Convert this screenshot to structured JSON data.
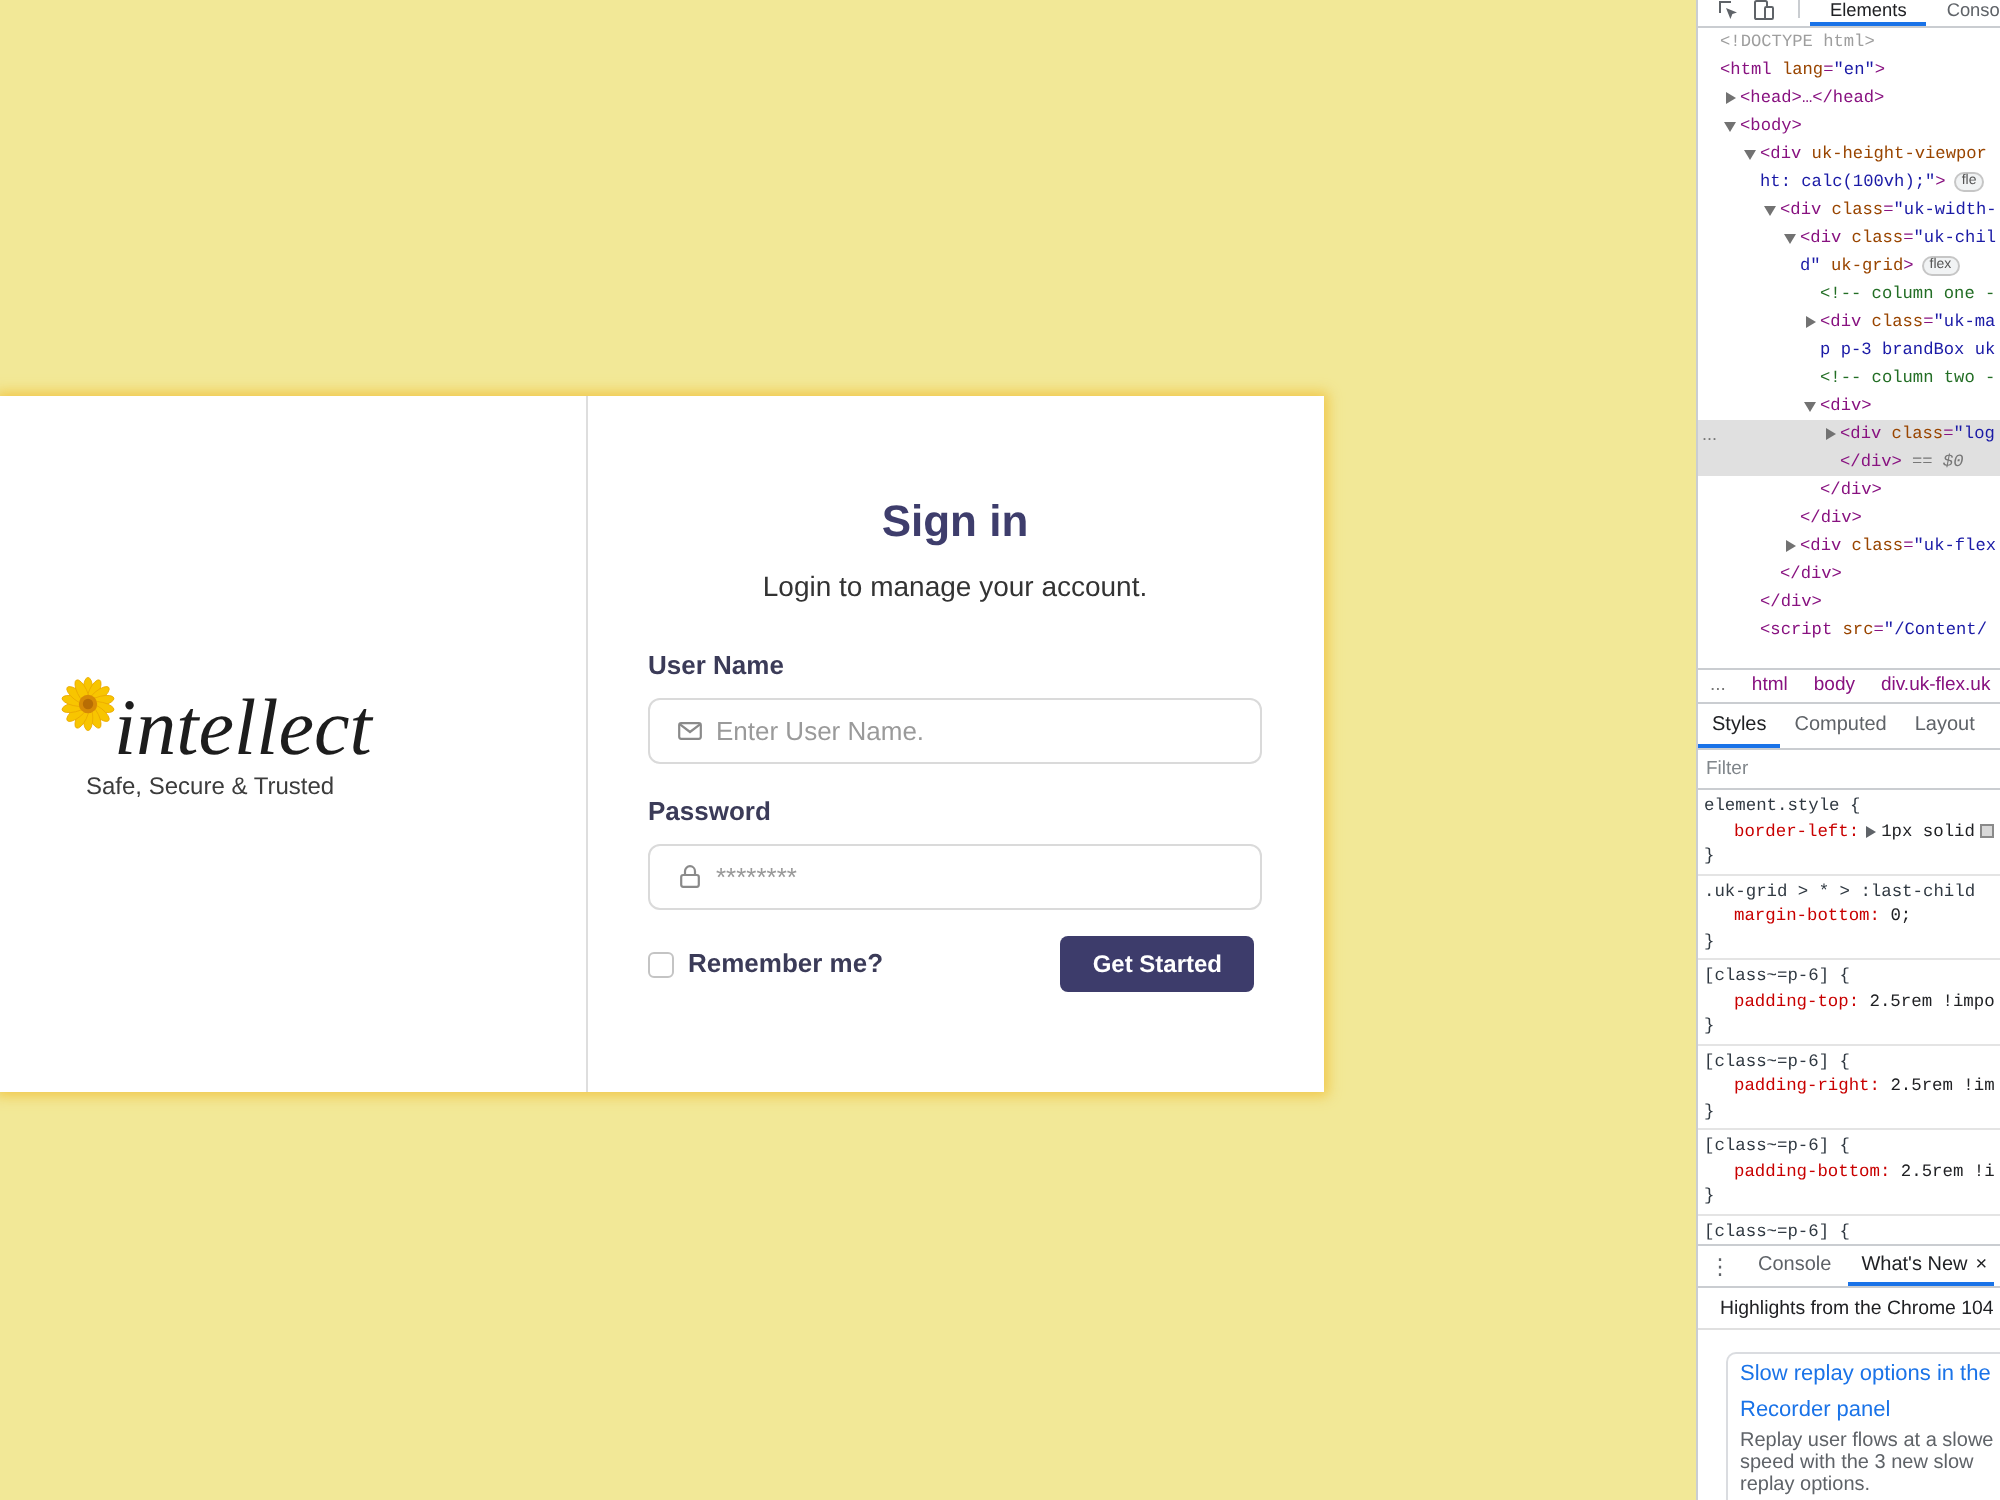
{
  "main": {
    "logo": {
      "wordmark": "intellect",
      "tagline": "Safe, Secure & Trusted"
    },
    "sign_in": {
      "title": "Sign in",
      "subtitle": "Login to manage your account.",
      "fields": [
        {
          "kind": "username",
          "label": "User Name",
          "placeholder": "Enter User Name."
        },
        {
          "kind": "password",
          "label": "Password",
          "placeholder": "********"
        }
      ],
      "remember": {
        "label": "Remember me?",
        "checked": false
      },
      "submit": "Get Started"
    }
  },
  "devtools": {
    "tabs": [
      {
        "label": "Elements",
        "selected": true
      },
      {
        "label": "Conso",
        "selected": false
      }
    ],
    "dom_tree": {
      "row_menu": "...",
      "nodes": [
        {
          "kind": "doctype",
          "lines": [
            "<!DOCTYPE html>"
          ],
          "selected": false
        },
        {
          "kind": "element",
          "lines": [
            "<html lang=\"en\">"
          ],
          "selected": false,
          "children": [
            {
              "kind": "element",
              "lines": [
                "<head>…</head>"
              ],
              "expanded": false,
              "selected": false
            },
            {
              "kind": "element",
              "lines": [
                "<body>"
              ],
              "expanded": true,
              "selected": false,
              "children": [
                {
                  "kind": "element",
                  "lines": [
                    "<div uk-height-viewpor",
                    "ht: calc(100vh);\">"
                  ],
                  "badge": "fle",
                  "expanded": true,
                  "selected": false,
                  "children": [
                    {
                      "kind": "element",
                      "lines": [
                        "<div class=\"uk-width-"
                      ],
                      "expanded": true,
                      "selected": false,
                      "children": [
                        {
                          "kind": "element",
                          "lines": [
                            "<div class=\"uk-chil",
                            "d\" uk-grid>"
                          ],
                          "badge": "flex",
                          "expanded": true,
                          "selected": false,
                          "children": [
                            {
                              "kind": "comment",
                              "lines": [
                                "<!-- column one -"
                              ],
                              "selected": false
                            },
                            {
                              "kind": "element",
                              "lines": [
                                "<div class=\"uk-ma",
                                "p p-3 brandBox uk"
                              ],
                              "expanded": false,
                              "selected": false
                            },
                            {
                              "kind": "comment",
                              "lines": [
                                "<!-- column two -"
                              ],
                              "selected": false
                            },
                            {
                              "kind": "element",
                              "lines": [
                                "<div>"
                              ],
                              "expanded": true,
                              "selected": false,
                              "children": [
                                {
                                  "kind": "element",
                                  "lines": [
                                    "<div class=\"log",
                                    "</div>"
                                  ],
                                  "console_ref": "== $0",
                                  "expanded": false,
                                  "selected": true
                                }
                              ],
                              "closing": "</div>"
                            }
                          ],
                          "closing": "</div>"
                        },
                        {
                          "kind": "element",
                          "lines": [
                            "<div class=\"uk-flex"
                          ],
                          "expanded": false,
                          "selected": false
                        }
                      ],
                      "closing": "</div>"
                    }
                  ],
                  "closing": "</div>"
                },
                {
                  "kind": "element",
                  "lines": [
                    "<script src=\"/Content/"
                  ],
                  "selected": false
                }
              ]
            }
          ]
        }
      ]
    },
    "breadcrumbs": {
      "more": "...",
      "items": [
        "html",
        "body",
        "div.uk-flex.uk"
      ]
    },
    "styles_tabs": [
      {
        "label": "Styles",
        "selected": true
      },
      {
        "label": "Computed",
        "selected": false
      },
      {
        "label": "Layout",
        "selected": false
      }
    ],
    "filter": {
      "placeholder": "Filter"
    },
    "rules": [
      {
        "selector": "element.style {",
        "declarations": [
          {
            "property": "border-left:",
            "value": "1px solid",
            "expandable": true,
            "swatch": true
          }
        ],
        "close": "}"
      },
      {
        "selector": ".uk-grid > * > :last-child",
        "declarations": [
          {
            "property": "margin-bottom:",
            "value": "0;"
          }
        ],
        "close": "}"
      },
      {
        "selector": "[class~=p-6] {",
        "declarations": [
          {
            "property": "padding-top:",
            "value": "2.5rem !impo"
          }
        ],
        "close": "}"
      },
      {
        "selector": "[class~=p-6] {",
        "declarations": [
          {
            "property": "padding-right:",
            "value": "2.5rem !im"
          }
        ],
        "close": "}"
      },
      {
        "selector": "[class~=p-6] {",
        "declarations": [
          {
            "property": "padding-bottom:",
            "value": "2.5rem !i"
          }
        ],
        "close": "}"
      },
      {
        "selector": "[class~=p-6] {"
      }
    ],
    "drawer": {
      "menu": "⋮",
      "tabs": [
        {
          "label": "Console",
          "selected": false
        },
        {
          "label": "What's New",
          "selected": true,
          "close": "×"
        }
      ],
      "banner": "Highlights from the Chrome 104",
      "card": {
        "title": "Slow replay options in the Recorder panel",
        "body": "Replay user flows at a slowe speed with the 3 new slow replay options."
      }
    }
  }
}
